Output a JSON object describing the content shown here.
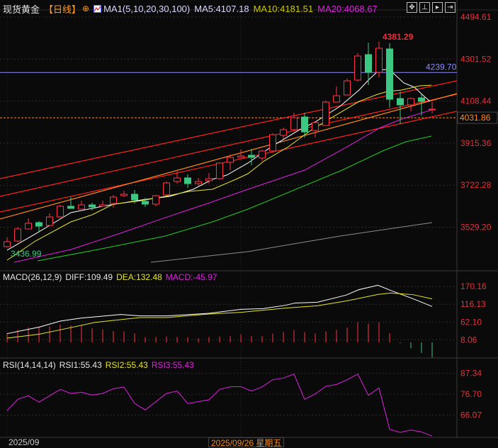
{
  "header": {
    "instrument": "现货黄金",
    "period": "【日线】",
    "ma_params": "MA1(5,10,20,30,100)",
    "ma5": "MA5:4107.18",
    "ma10": "MA10:4181.51",
    "ma20": "MA20:4068.67",
    "toolbar_icons": [
      "crosshair-icon",
      "axis-left-icon",
      "axis-play-icon",
      "axis-right-icon"
    ]
  },
  "macd_header": {
    "params": "MACD(26,12,9)",
    "diff": "DIFF:109.49",
    "dea": "DEA:132.48",
    "macd": "MACD:-45.97"
  },
  "rsi_header": {
    "params": "RSI(14,14,14)",
    "rsi1": "RSI1:55.43",
    "rsi2": "RSI2:55.43",
    "rsi3": "RSI3:55.43"
  },
  "x_axis": {
    "start_label": "2025/09",
    "cursor_label": "2025/09/26 星期五"
  },
  "colors": {
    "up": "#ff3348",
    "down": "#3cc882",
    "ma5": "#ffffff",
    "ma10": "#e6e628",
    "ma20": "#e020e0",
    "ma30": "#22cc22",
    "ma100": "#8c8c8c",
    "axis": "#e8303a",
    "hline": "#8c8cff",
    "current": "#ff8c1a"
  },
  "chart_data": {
    "type": "candlestick",
    "title": "现货黄金 日线",
    "y_ticks": [
      "4494.61",
      "4301.52",
      "4108.44",
      "3915.36",
      "3722.28",
      "3529.20"
    ],
    "high_label": {
      "index": 35,
      "value": "4381.29"
    },
    "low_label": {
      "index": 0,
      "value": "3436.99"
    },
    "hline": {
      "value": 4239.7,
      "label": "4239.70"
    },
    "current_price": {
      "value": 4031.86,
      "label": "4031.86"
    },
    "candles": [
      [
        3440.0,
        3481.99,
        3436.99,
        3462.4
      ],
      [
        3465.7,
        3530.8,
        3462.4,
        3521.1
      ],
      [
        3521.1,
        3569.9,
        3517.8,
        3547.1
      ],
      [
        3550.4,
        3556.9,
        3504.8,
        3534.1
      ],
      [
        3537.3,
        3592.7,
        3537.3,
        3576.4
      ],
      [
        3576.4,
        3631.8,
        3573.2,
        3625.3
      ],
      [
        3625.3,
        3667.6,
        3615.5,
        3615.5
      ],
      [
        3612.2,
        3651.3,
        3612.2,
        3631.8
      ],
      [
        3631.8,
        3641.5,
        3605.7,
        3622.0
      ],
      [
        3625.3,
        3651.3,
        3625.3,
        3631.8
      ],
      [
        3638.3,
        3677.4,
        3618.7,
        3667.6
      ],
      [
        3674.1,
        3696.9,
        3667.6,
        3680.6
      ],
      [
        3680.6,
        3700.1,
        3638.3,
        3654.6
      ],
      [
        3648.0,
        3664.3,
        3622.0,
        3635.0
      ],
      [
        3635.0,
        3677.4,
        3625.3,
        3674.1
      ],
      [
        3677.4,
        3739.2,
        3674.1,
        3732.7
      ],
      [
        3739.2,
        3784.8,
        3729.4,
        3755.5
      ],
      [
        3755.5,
        3771.8,
        3709.9,
        3729.4
      ],
      [
        3729.4,
        3755.5,
        3719.7,
        3739.2
      ],
      [
        3742.5,
        3778.3,
        3729.4,
        3752.2
      ],
      [
        3752.2,
        3827.1,
        3749.0,
        3823.9
      ],
      [
        3827.1,
        3862.9,
        3791.3,
        3849.9
      ],
      [
        3849.9,
        3885.7,
        3849.9,
        3856.4
      ],
      [
        3859.7,
        3889.0,
        3814.1,
        3849.9
      ],
      [
        3846.7,
        3885.7,
        3833.6,
        3879.2
      ],
      [
        3879.2,
        3960.6,
        3879.2,
        3954.1
      ],
      [
        3950.8,
        3986.7,
        3934.6,
        3976.9
      ],
      [
        3976.9,
        4055.1,
        3973.7,
        4032.3
      ],
      [
        4035.5,
        4055.1,
        3941.1,
        3967.1
      ],
      [
        3973.7,
        4016.0,
        3941.1,
        4009.5
      ],
      [
        3996.4,
        4110.4,
        3996.4,
        4103.9
      ],
      [
        4103.9,
        4175.5,
        4103.9,
        4133.2
      ],
      [
        4136.5,
        4211.3,
        4136.5,
        4201.6
      ],
      [
        4204.8,
        4328.6,
        4198.3,
        4315.5
      ],
      [
        4322.0,
        4377.4,
        4182.0,
        4240.6
      ],
      [
        4240.6,
        4381.29,
        4217.9,
        4351.3
      ],
      [
        4348.1,
        4374.1,
        4077.8,
        4116.9
      ],
      [
        4120.2,
        4152.7,
        4002.9,
        4090.9
      ],
      [
        4090.9,
        4125.0,
        4061.6,
        4120.2
      ],
      [
        4123.4,
        4139.7,
        4042.0,
        4107.1
      ],
      [
        4068.1,
        4103.9,
        4051.8,
        4071.3
      ]
    ],
    "moving_averages": [
      {
        "name": "MA5",
        "color": "#ffffff",
        "points": [
          [
            0,
            3423.4
          ],
          [
            2.67,
            3498.3
          ],
          [
            4.67,
            3556.9
          ],
          [
            6,
            3596.0
          ],
          [
            9.33,
            3628.5
          ],
          [
            12.67,
            3654.6
          ],
          [
            15.33,
            3670.8
          ],
          [
            17.53,
            3703.4
          ],
          [
            19.33,
            3749.0
          ],
          [
            20.67,
            3768.5
          ],
          [
            22.67,
            3823.9
          ],
          [
            24.87,
            3898.7
          ],
          [
            27.53,
            3976.9
          ],
          [
            29,
            4012.7
          ],
          [
            31.33,
            4084.3
          ],
          [
            33.13,
            4159.2
          ],
          [
            34,
            4204.8
          ],
          [
            35,
            4250.4
          ],
          [
            35.67,
            4253.7
          ],
          [
            36.33,
            4237.4
          ],
          [
            37.33,
            4191.8
          ],
          [
            38.33,
            4172.3
          ],
          [
            39.33,
            4126.7
          ],
          [
            39.8,
            4107.18
          ]
        ]
      },
      {
        "name": "MA10",
        "color": "#e6e628",
        "points": [
          [
            0,
            3377.8
          ],
          [
            2.67,
            3465.7
          ],
          [
            6,
            3553.6
          ],
          [
            8,
            3586.2
          ],
          [
            10,
            3635.0
          ],
          [
            12.67,
            3651.3
          ],
          [
            14.87,
            3670.8
          ],
          [
            17.13,
            3693.6
          ],
          [
            19.33,
            3703.4
          ],
          [
            21.53,
            3749.0
          ],
          [
            22.67,
            3775.0
          ],
          [
            24.2,
            3833.6
          ],
          [
            26.47,
            3898.7
          ],
          [
            28.67,
            3976.9
          ],
          [
            30.87,
            4041.9
          ],
          [
            33.13,
            4107.1
          ],
          [
            34.87,
            4139.7
          ],
          [
            35.8,
            4152.7
          ],
          [
            37.13,
            4159.2
          ],
          [
            38.87,
            4178.8
          ],
          [
            39.93,
            4181.51
          ]
        ]
      },
      {
        "name": "MA20",
        "color": "#e020e0",
        "points": [
          [
            0.67,
            3368.0
          ],
          [
            6,
            3426.6
          ],
          [
            10.47,
            3498.3
          ],
          [
            14.87,
            3572.9
          ],
          [
            18.87,
            3638.3
          ],
          [
            22.67,
            3703.4
          ],
          [
            28,
            3791.3
          ],
          [
            32,
            3898.7
          ],
          [
            35.13,
            3986.7
          ],
          [
            37.13,
            4025.7
          ],
          [
            40,
            4068.67
          ]
        ]
      },
      {
        "name": "MA30",
        "color": "#22cc22",
        "points": [
          [
            2.87,
            3374.5
          ],
          [
            8.2,
            3423.4
          ],
          [
            14.87,
            3488.6
          ],
          [
            19.33,
            3553.6
          ],
          [
            22.67,
            3612.2
          ],
          [
            31.53,
            3791.3
          ],
          [
            35.33,
            3879.2
          ],
          [
            37.53,
            3921.5
          ],
          [
            39.93,
            3947.6
          ]
        ]
      },
      {
        "name": "MA100",
        "color": "#8c8c8c",
        "points": [
          [
            13.53,
            3368.0
          ],
          [
            22.67,
            3416.9
          ],
          [
            31.33,
            3488.6
          ],
          [
            40,
            3550.5
          ]
        ]
      }
    ],
    "trendlines": [
      {
        "color": "#ff2020",
        "from": [
          -0.67,
          3752.3
        ],
        "to": [
          42.33,
          4201.6
        ]
      },
      {
        "color": "#ff2020",
        "from": [
          -0.67,
          3670.8
        ],
        "to": [
          42.33,
          4139.7
        ]
      },
      {
        "color": "#ff2020",
        "from": [
          -0.67,
          3599.2
        ],
        "to": [
          42.33,
          4061.6
        ]
      },
      {
        "color": "#ff8c1a",
        "from": [
          -0.67,
          3566.7
        ],
        "to": [
          42.33,
          4142.9
        ]
      }
    ],
    "macd": {
      "y_ticks": [
        "170.16",
        "116.13",
        "62.10",
        "8.06"
      ],
      "diff": [
        [
          0,
          26.6
        ],
        [
          3.04,
          46.8
        ],
        [
          5,
          64.8
        ],
        [
          7,
          74.2
        ],
        [
          10.7,
          85
        ],
        [
          12.5,
          80.6
        ],
        [
          15,
          80.6
        ],
        [
          19,
          88.6
        ],
        [
          22,
          100.8
        ],
        [
          24.1,
          103
        ],
        [
          26.2,
          113
        ],
        [
          27.1,
          120
        ],
        [
          29.2,
          122.4
        ],
        [
          31.9,
          144
        ],
        [
          33.1,
          160.6
        ],
        [
          34.9,
          174
        ],
        [
          36.1,
          158.4
        ],
        [
          38.2,
          133
        ],
        [
          40,
          109.49
        ]
      ],
      "dea": [
        [
          0,
          13
        ],
        [
          3.04,
          25.2
        ],
        [
          5,
          38.2
        ],
        [
          8.3,
          61
        ],
        [
          12.5,
          75.6
        ],
        [
          15,
          75.6
        ],
        [
          19,
          86.4
        ],
        [
          22,
          91.4
        ],
        [
          26.2,
          104.4
        ],
        [
          29.2,
          111.6
        ],
        [
          31.9,
          126
        ],
        [
          34.9,
          146
        ],
        [
          36.1,
          150.5
        ],
        [
          38.2,
          145.4
        ],
        [
          40,
          132.48
        ]
      ],
      "hist": [
        28.8,
        38.2,
        45.4,
        46.8,
        48.2,
        54,
        51.8,
        51.8,
        43.2,
        39.6,
        34.6,
        33.8,
        26.6,
        15.8,
        16.6,
        18,
        16.6,
        15.8,
        13,
        16.6,
        18,
        19.4,
        23.8,
        19.4,
        19.4,
        26.6,
        31,
        37.4,
        31,
        26.6,
        33.8,
        38.2,
        45.4,
        61.2,
        56.9,
        61.2,
        28.1,
        -2.2,
        -18,
        -32.4,
        -45.97
      ]
    },
    "rsi": {
      "y_ticks": [
        "87.34",
        "76.70",
        "66.07"
      ],
      "values": [
        68.35,
        74.12,
        75.92,
        72.68,
        75.92,
        79.17,
        77.12,
        77.72,
        76.28,
        77.12,
        79.53,
        80.37,
        72.07,
        68.71,
        72.92,
        77.12,
        78.32,
        71.95,
        72.92,
        73.88,
        79.17,
        80.49,
        80.61,
        78.32,
        80.49,
        84.09,
        84.94,
        86.98,
        74.12,
        76.88,
        80.73,
        81.69,
        84.09,
        86.98,
        76.16,
        79.89,
        58.85,
        57.29,
        58.49,
        57.53,
        55.43
      ]
    }
  }
}
